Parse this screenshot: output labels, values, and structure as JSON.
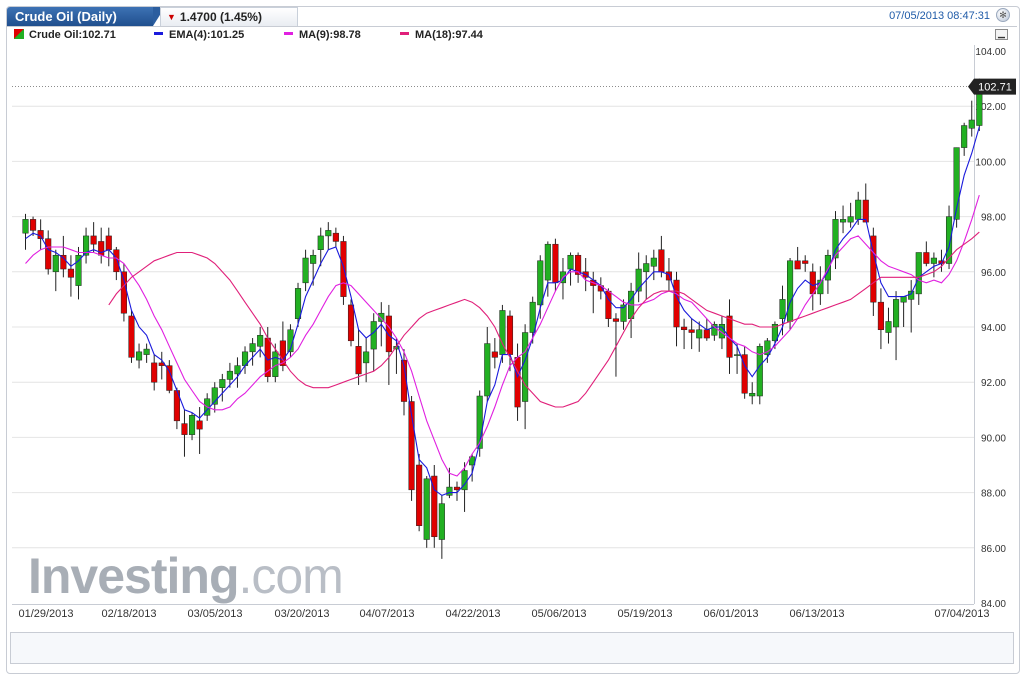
{
  "header": {
    "title": "Crude Oil (Daily)",
    "change": "1.4700 (1.45%)",
    "change_direction": "down-arrow-icon",
    "datetime": "07/05/2013 08:47:31",
    "settings_icon": "settings-icon"
  },
  "legend": {
    "instrument": "Crude Oil:102.71",
    "ema": "EMA(4):101.25",
    "ma9": "MA(9):98.78",
    "ma18": "MA(18):97.44"
  },
  "colors": {
    "up_candle": "#22b022",
    "down_candle": "#e00000",
    "ema": "#1a1adc",
    "ma9": "#e020e0",
    "ma18": "#e0207a",
    "brand": "#2b5ea2"
  },
  "watermark": {
    "brand": "Investing",
    "suffix": ".com"
  },
  "chart_data": {
    "type": "candlestick",
    "title": "Crude Oil (Daily)",
    "ylim": [
      84,
      104
    ],
    "y_ticks": [
      "104.00",
      "102.00",
      "100.00",
      "98.00",
      "96.00",
      "94.00",
      "92.00",
      "90.00",
      "88.00",
      "86.00",
      "84.00"
    ],
    "x_ticks": [
      "01/29/2013",
      "02/18/2013",
      "03/05/2013",
      "03/20/2013",
      "04/07/2013",
      "04/22/2013",
      "05/06/2013",
      "05/19/2013",
      "06/01/2013",
      "06/13/2013",
      "07/04/2013"
    ],
    "last_price_label": "102.71",
    "grid": true,
    "candles": [
      [
        97.4,
        98.1,
        96.8,
        97.9
      ],
      [
        97.9,
        98.0,
        97.3,
        97.5
      ],
      [
        97.5,
        97.9,
        96.8,
        97.2
      ],
      [
        97.2,
        97.5,
        95.9,
        96.1
      ],
      [
        96.0,
        96.8,
        95.3,
        96.6
      ],
      [
        96.6,
        97.3,
        95.8,
        96.1
      ],
      [
        96.1,
        96.6,
        95.1,
        95.8
      ],
      [
        95.5,
        96.9,
        95.0,
        96.6
      ],
      [
        96.6,
        97.6,
        96.3,
        97.3
      ],
      [
        97.3,
        97.8,
        96.7,
        97.0
      ],
      [
        97.1,
        97.6,
        96.3,
        96.6
      ],
      [
        97.3,
        97.6,
        96.2,
        96.8
      ],
      [
        96.8,
        96.9,
        95.7,
        96.0
      ],
      [
        96.0,
        96.3,
        94.2,
        94.5
      ],
      [
        94.4,
        94.6,
        92.7,
        92.9
      ],
      [
        92.8,
        93.4,
        92.5,
        93.1
      ],
      [
        93.0,
        93.4,
        92.7,
        93.2
      ],
      [
        92.7,
        93.0,
        91.7,
        92.0
      ],
      [
        92.7,
        93.1,
        92.1,
        92.6
      ],
      [
        92.6,
        92.8,
        91.6,
        91.7
      ],
      [
        91.7,
        91.8,
        90.3,
        90.6
      ],
      [
        90.5,
        91.0,
        89.3,
        90.1
      ],
      [
        90.1,
        90.9,
        89.9,
        90.8
      ],
      [
        90.6,
        91.1,
        89.4,
        90.3
      ],
      [
        90.8,
        91.6,
        90.6,
        91.4
      ],
      [
        91.2,
        92.0,
        90.9,
        91.8
      ],
      [
        91.8,
        92.3,
        91.3,
        92.1
      ],
      [
        92.1,
        92.7,
        91.8,
        92.4
      ],
      [
        92.3,
        92.9,
        91.8,
        92.6
      ],
      [
        92.6,
        93.3,
        92.3,
        93.1
      ],
      [
        93.1,
        93.6,
        92.6,
        93.4
      ],
      [
        93.3,
        94.0,
        92.9,
        93.7
      ],
      [
        93.6,
        94.0,
        92.0,
        92.2
      ],
      [
        92.2,
        93.4,
        92.0,
        93.1
      ],
      [
        93.5,
        94.2,
        92.4,
        92.6
      ],
      [
        93.1,
        94.1,
        92.9,
        93.9
      ],
      [
        94.3,
        95.6,
        94.0,
        95.4
      ],
      [
        95.6,
        96.8,
        95.3,
        96.5
      ],
      [
        96.3,
        96.8,
        95.5,
        96.6
      ],
      [
        96.8,
        97.6,
        96.2,
        97.3
      ],
      [
        97.3,
        97.8,
        96.8,
        97.5
      ],
      [
        97.4,
        97.6,
        96.9,
        97.1
      ],
      [
        97.1,
        97.3,
        94.8,
        95.1
      ],
      [
        94.8,
        95.0,
        93.3,
        93.5
      ],
      [
        93.3,
        93.9,
        91.9,
        92.3
      ],
      [
        92.7,
        93.6,
        92.0,
        93.1
      ],
      [
        93.2,
        94.5,
        92.4,
        94.2
      ],
      [
        94.2,
        94.9,
        93.3,
        94.5
      ],
      [
        94.4,
        94.8,
        91.9,
        93.1
      ],
      [
        93.2,
        93.6,
        92.3,
        93.3
      ],
      [
        92.8,
        93.2,
        90.8,
        91.3
      ],
      [
        91.3,
        91.5,
        87.7,
        88.1
      ],
      [
        89.0,
        89.4,
        86.6,
        86.8
      ],
      [
        86.3,
        88.6,
        86.0,
        88.5
      ],
      [
        88.6,
        89.0,
        86.0,
        86.4
      ],
      [
        86.3,
        87.9,
        85.6,
        87.6
      ],
      [
        87.9,
        88.9,
        87.8,
        88.2
      ],
      [
        88.2,
        88.4,
        87.7,
        88.1
      ],
      [
        88.1,
        89.1,
        87.3,
        88.8
      ],
      [
        89.0,
        89.4,
        88.4,
        89.3
      ],
      [
        89.6,
        91.7,
        89.3,
        91.5
      ],
      [
        91.5,
        94.0,
        91.3,
        93.4
      ],
      [
        93.1,
        93.6,
        92.5,
        92.9
      ],
      [
        93.0,
        94.8,
        92.7,
        94.6
      ],
      [
        94.4,
        94.6,
        92.4,
        93.0
      ],
      [
        92.9,
        93.4,
        90.6,
        91.1
      ],
      [
        91.3,
        94.1,
        90.3,
        93.8
      ],
      [
        93.8,
        95.1,
        93.4,
        94.9
      ],
      [
        94.8,
        96.6,
        94.3,
        96.4
      ],
      [
        95.7,
        97.1,
        95.1,
        97.0
      ],
      [
        97.0,
        97.2,
        95.3,
        95.6
      ],
      [
        95.6,
        96.5,
        95.0,
        96.0
      ],
      [
        96.1,
        96.7,
        95.5,
        96.6
      ],
      [
        96.6,
        96.7,
        95.6,
        95.9
      ],
      [
        96.0,
        96.5,
        95.3,
        95.8
      ],
      [
        95.7,
        96.0,
        94.5,
        95.5
      ],
      [
        95.5,
        95.8,
        95.0,
        95.3
      ],
      [
        95.3,
        95.4,
        94.0,
        94.3
      ],
      [
        94.3,
        94.5,
        92.2,
        94.2
      ],
      [
        94.2,
        95.0,
        93.9,
        94.8
      ],
      [
        94.3,
        95.6,
        93.6,
        95.3
      ],
      [
        95.3,
        96.7,
        94.9,
        96.1
      ],
      [
        96.0,
        96.6,
        95.0,
        96.3
      ],
      [
        96.2,
        96.8,
        95.7,
        96.5
      ],
      [
        96.8,
        97.3,
        95.8,
        96.0
      ],
      [
        96.0,
        96.5,
        95.3,
        95.7
      ],
      [
        95.7,
        96.0,
        93.3,
        94.0
      ],
      [
        94.0,
        94.3,
        93.2,
        93.9
      ],
      [
        93.9,
        94.3,
        93.2,
        93.8
      ],
      [
        93.6,
        94.2,
        93.1,
        93.9
      ],
      [
        93.9,
        94.3,
        93.5,
        93.6
      ],
      [
        93.7,
        94.2,
        93.5,
        94.1
      ],
      [
        93.6,
        94.4,
        93.2,
        94.1
      ],
      [
        94.4,
        95.0,
        92.3,
        92.9
      ],
      [
        93.0,
        93.4,
        92.3,
        93.0
      ],
      [
        93.0,
        93.3,
        91.4,
        91.6
      ],
      [
        91.5,
        92.0,
        91.2,
        91.6
      ],
      [
        91.5,
        93.4,
        91.2,
        93.3
      ],
      [
        93.0,
        93.6,
        92.7,
        93.5
      ],
      [
        93.5,
        94.2,
        93.2,
        94.1
      ],
      [
        94.3,
        95.5,
        93.7,
        95.0
      ],
      [
        94.2,
        96.5,
        93.9,
        96.4
      ],
      [
        96.4,
        96.9,
        96.1,
        96.1
      ],
      [
        96.4,
        96.6,
        96.0,
        96.3
      ],
      [
        96.0,
        96.3,
        94.6,
        95.2
      ],
      [
        95.2,
        96.2,
        94.8,
        95.7
      ],
      [
        95.7,
        96.8,
        95.2,
        96.6
      ],
      [
        96.5,
        98.2,
        96.1,
        97.9
      ],
      [
        97.8,
        98.4,
        97.4,
        97.9
      ],
      [
        97.8,
        98.5,
        97.6,
        98.0
      ],
      [
        97.9,
        98.9,
        97.7,
        98.6
      ],
      [
        98.6,
        99.2,
        97.8,
        97.8
      ],
      [
        97.3,
        97.6,
        94.4,
        94.9
      ],
      [
        94.9,
        95.4,
        93.2,
        93.9
      ],
      [
        93.8,
        94.7,
        93.4,
        94.2
      ],
      [
        94.0,
        95.3,
        92.8,
        95.0
      ],
      [
        94.9,
        95.1,
        94.0,
        95.1
      ],
      [
        95.0,
        95.7,
        93.8,
        95.3
      ],
      [
        95.2,
        96.7,
        94.8,
        96.7
      ],
      [
        96.7,
        97.1,
        96.2,
        96.3
      ],
      [
        96.3,
        96.7,
        95.8,
        96.5
      ],
      [
        96.4,
        96.8,
        96.0,
        96.3
      ],
      [
        96.3,
        98.4,
        96.1,
        98.0
      ],
      [
        97.9,
        100.5,
        97.6,
        100.5
      ],
      [
        100.5,
        101.4,
        100.2,
        101.3
      ],
      [
        101.2,
        102.2,
        100.9,
        101.5
      ],
      [
        101.3,
        103.0,
        101.1,
        102.71
      ]
    ],
    "series": [
      {
        "name": "EMA(4)",
        "values": [
          97.2,
          97.4,
          97.3,
          96.8,
          96.7,
          96.5,
          96.2,
          96.4,
          96.7,
          96.8,
          96.7,
          96.8,
          96.5,
          95.7,
          94.6,
          94.0,
          93.7,
          93.0,
          92.8,
          92.4,
          91.7,
          91.0,
          90.9,
          90.7,
          91.0,
          91.3,
          91.6,
          91.9,
          92.2,
          92.6,
          92.9,
          93.2,
          92.8,
          92.9,
          92.8,
          93.2,
          94.1,
          95.1,
          95.7,
          96.3,
          96.8,
          96.9,
          96.2,
          95.1,
          93.9,
          93.6,
          93.8,
          94.1,
          93.7,
          93.5,
          92.6,
          90.8,
          89.2,
          88.9,
          88.1,
          87.9,
          88.0,
          88.0,
          88.3,
          88.7,
          89.8,
          91.3,
          91.9,
          93.0,
          93.0,
          92.2,
          92.8,
          93.6,
          94.7,
          95.6,
          95.6,
          95.7,
          96.1,
          96.0,
          95.9,
          95.7,
          95.5,
          95.0,
          94.7,
          94.7,
          95.0,
          95.4,
          95.7,
          96.0,
          96.0,
          95.9,
          95.1,
          94.6,
          94.3,
          94.1,
          93.9,
          94.0,
          94.0,
          93.6,
          93.3,
          92.6,
          92.2,
          92.6,
          92.9,
          93.4,
          94.0,
          94.9,
          95.4,
          95.7,
          95.5,
          95.6,
          96.0,
          96.8,
          97.2,
          97.5,
          97.9,
          97.9,
          96.7,
          95.6,
          95.1,
          95.1,
          95.1,
          95.2,
          95.8,
          96.0,
          96.2,
          96.3,
          96.9,
          98.3,
          99.5,
          100.3,
          101.25
        ]
      },
      {
        "name": "MA(9)",
        "values": [
          96.3,
          96.6,
          96.8,
          96.9,
          96.9,
          96.9,
          96.8,
          96.7,
          96.7,
          96.7,
          96.6,
          96.5,
          96.5,
          96.3,
          95.9,
          95.5,
          95.0,
          94.4,
          93.9,
          93.3,
          92.7,
          92.1,
          91.7,
          91.3,
          91.1,
          91.0,
          91.0,
          91.1,
          91.4,
          91.6,
          91.9,
          92.2,
          92.4,
          92.6,
          92.7,
          92.9,
          93.2,
          93.7,
          94.1,
          94.6,
          95.1,
          95.5,
          95.6,
          95.5,
          95.2,
          94.9,
          94.6,
          94.3,
          94.0,
          93.6,
          93.1,
          92.4,
          91.5,
          90.6,
          89.9,
          89.2,
          88.7,
          88.6,
          88.9,
          89.4,
          89.8,
          90.4,
          91.1,
          91.9,
          92.6,
          92.9,
          93.1,
          93.6,
          94.1,
          94.7,
          95.3,
          95.8,
          96.0,
          96.0,
          95.7,
          95.6,
          95.5,
          95.3,
          95.1,
          94.9,
          94.8,
          94.8,
          94.9,
          95.0,
          95.2,
          95.3,
          95.2,
          95.0,
          94.9,
          94.6,
          94.3,
          94.0,
          93.8,
          93.6,
          93.4,
          93.3,
          93.1,
          93.0,
          93.1,
          93.3,
          93.6,
          93.9,
          94.3,
          94.8,
          95.2,
          95.6,
          96.1,
          96.6,
          96.9,
          97.2,
          97.3,
          97.0,
          96.7,
          96.4,
          96.2,
          96.1,
          96.0,
          95.9,
          95.7,
          95.6,
          95.7,
          95.6,
          95.9,
          96.4,
          97.1,
          97.9,
          98.78
        ]
      },
      {
        "name": "MA(18)",
        "values": [
          94.8,
          95.2,
          95.5,
          95.8,
          96.0,
          96.2,
          96.4,
          96.5,
          96.6,
          96.7,
          96.7,
          96.7,
          96.6,
          96.5,
          96.3,
          96.0,
          95.7,
          95.3,
          94.9,
          94.5,
          94.1,
          93.6,
          93.2,
          92.8,
          92.4,
          92.1,
          91.9,
          91.8,
          91.8,
          91.8,
          91.9,
          92.0,
          92.1,
          92.2,
          92.3,
          92.4,
          92.6,
          92.9,
          93.3,
          93.7,
          94.0,
          94.3,
          94.5,
          94.6,
          94.7,
          94.8,
          94.9,
          95.0,
          94.9,
          94.7,
          94.4,
          94.0,
          93.4,
          92.9,
          92.4,
          91.9,
          91.6,
          91.3,
          91.2,
          91.1,
          91.1,
          91.2,
          91.3,
          91.6,
          92.0,
          92.4,
          92.8,
          93.3,
          93.8,
          94.3,
          94.7,
          95.0,
          95.2,
          95.3,
          95.3,
          95.3,
          95.2,
          95.0,
          94.8,
          94.6,
          94.5,
          94.4,
          94.3,
          94.2,
          94.1,
          94.1,
          94.0,
          94.0,
          94.0,
          94.1,
          94.2,
          94.3,
          94.4,
          94.5,
          94.6,
          94.7,
          94.8,
          94.9,
          95.0,
          95.2,
          95.4,
          95.6,
          95.8,
          95.8,
          95.8,
          95.8,
          95.8,
          95.8,
          95.9,
          96.0,
          96.2,
          96.5,
          96.8,
          97.0,
          97.2,
          97.44
        ]
      }
    ]
  }
}
